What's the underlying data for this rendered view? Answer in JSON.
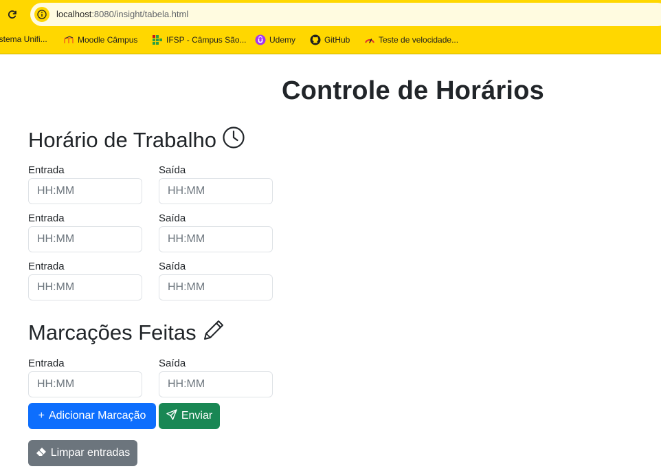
{
  "browser": {
    "url_host": "localhost",
    "url_path": ":8080/insight/tabela.html",
    "bookmarks": [
      {
        "label": "istema Unifi...",
        "icon": "none"
      },
      {
        "label": "Moodle Câmpus",
        "icon": "moodle-icon"
      },
      {
        "label": "IFSP - Câmpus São...",
        "icon": "ifsp-icon"
      },
      {
        "label": "Udemy",
        "icon": "udemy-icon"
      },
      {
        "label": "GitHub",
        "icon": "github-icon"
      },
      {
        "label": "Teste de velocidade...",
        "icon": "speedtest-icon"
      }
    ],
    "chrome_color": "#ffd700"
  },
  "page": {
    "title": "Controle de Horários",
    "work_section": {
      "title": "Horário de Trabalho",
      "icon": "clock-icon",
      "rows": [
        {
          "entrada_label": "Entrada",
          "saida_label": "Saída",
          "entrada_placeholder": "HH:MM",
          "saida_placeholder": "HH:MM"
        },
        {
          "entrada_label": "Entrada",
          "saida_label": "Saída",
          "entrada_placeholder": "HH:MM",
          "saida_placeholder": "HH:MM"
        },
        {
          "entrada_label": "Entrada",
          "saida_label": "Saída",
          "entrada_placeholder": "HH:MM",
          "saida_placeholder": "HH:MM"
        }
      ]
    },
    "marks_section": {
      "title": "Marcações Feitas",
      "icon": "pencil-icon",
      "rows": [
        {
          "entrada_label": "Entrada",
          "saida_label": "Saída",
          "entrada_placeholder": "HH:MM",
          "saida_placeholder": "HH:MM"
        }
      ]
    },
    "buttons": {
      "add": {
        "label": "Adicionar Marcação",
        "icon": "plus-icon",
        "color": "#0d6efd"
      },
      "send": {
        "label": "Enviar",
        "icon": "send-icon",
        "color": "#198754"
      },
      "clear": {
        "label": "Limpar entradas",
        "icon": "eraser-icon",
        "color": "#6c757d"
      }
    }
  }
}
